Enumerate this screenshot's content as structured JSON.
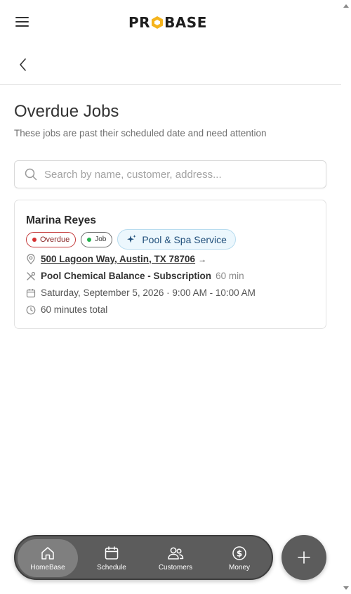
{
  "brand": {
    "logo_text_left": "PR",
    "logo_text_right": "BASE",
    "accent": "#f5b41d"
  },
  "page": {
    "title": "Overdue Jobs",
    "subtitle": "These jobs are past their scheduled date and need attention"
  },
  "search": {
    "placeholder": "Search by name, customer, address...",
    "value": ""
  },
  "jobs": [
    {
      "customer": "Marina Reyes",
      "status_badge": "Overdue",
      "type_badge": "Job",
      "service_category": "Pool & Spa Service",
      "address": "500 Lagoon Way, Austin, TX 78706",
      "address_arrow": "→",
      "service_name": "Pool Chemical Balance - Subscription",
      "service_duration": "60 min",
      "schedule": "Saturday, September 5, 2026 · 9:00 AM - 10:00 AM",
      "total_time": "60 minutes total"
    }
  ],
  "nav": {
    "items": [
      {
        "label": "HomeBase",
        "icon": "home-icon",
        "active": true
      },
      {
        "label": "Schedule",
        "icon": "calendar-icon",
        "active": false
      },
      {
        "label": "Customers",
        "icon": "users-icon",
        "active": false
      },
      {
        "label": "Money",
        "icon": "dollar-icon",
        "active": false
      }
    ],
    "fab_icon": "plus-icon"
  },
  "colors": {
    "overdue": "#d63131",
    "job_dot": "#22b24c",
    "service_chip_bg": "#ecf7fd",
    "nav_bg": "#5c5c5c"
  }
}
